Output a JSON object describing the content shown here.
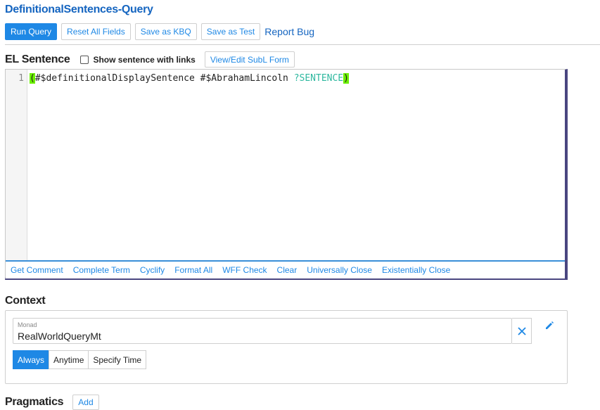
{
  "title": "DefinitionalSentences-Query",
  "toolbar": {
    "run_query": "Run Query",
    "reset_all": "Reset All Fields",
    "save_kbq": "Save as KBQ",
    "save_test": "Save as Test",
    "report_bug": "Report Bug"
  },
  "el_sentence": {
    "heading": "EL Sentence",
    "show_links_label": "Show sentence with links",
    "show_links_checked": false,
    "view_edit_subl": "View/Edit SubL Form"
  },
  "editor": {
    "line_number": "1",
    "open_paren": "(",
    "code_text": "#$definitionalDisplaySentence #$AbrahamLincoln ",
    "variable": "?SENTENCE",
    "close_paren": ")",
    "actions": [
      "Get Comment",
      "Complete Term",
      "Cyclify",
      "Format All",
      "WFF Check",
      "Clear",
      "Universally Close",
      "Existentially Close"
    ]
  },
  "context": {
    "heading": "Context",
    "monad_label": "Monad",
    "monad_value": "RealWorldQueryMt",
    "time_options": [
      "Always",
      "Anytime",
      "Specify Time"
    ],
    "selected_time": "Always"
  },
  "pragmatics": {
    "heading": "Pragmatics",
    "add_label": "Add"
  },
  "colors": {
    "accent": "#1e88e5",
    "title": "#1565c0",
    "editor_border": "#4a4680",
    "paren_highlight": "#6cf000",
    "variable": "#2eb89f"
  }
}
